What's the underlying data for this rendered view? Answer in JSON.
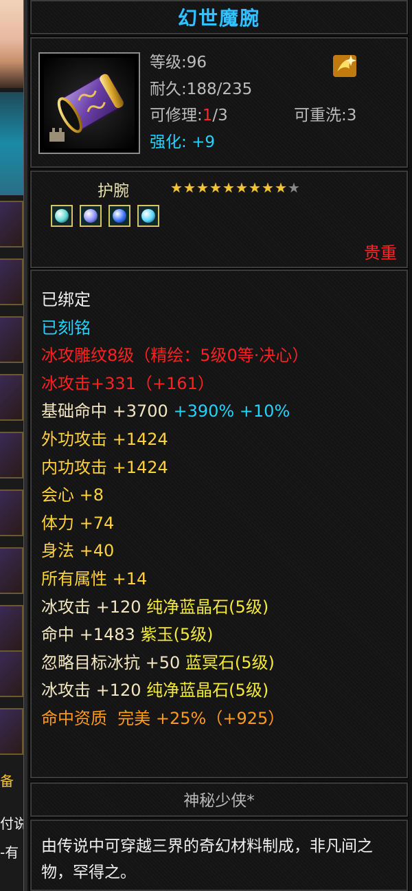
{
  "side_panel": {
    "visible_text": [
      "备",
      "付说",
      "-有"
    ]
  },
  "item": {
    "name": "幻世魔腕",
    "level_label": "等级",
    "level_value": ":96",
    "durability_label": "耐久",
    "durability_value": ":188/235",
    "repair_label": "可修理:",
    "repair_used": "1",
    "repair_total": "/3",
    "rewash_label": "可重洗:",
    "rewash_value": "3",
    "enhance_label": "强化:",
    "enhance_value": "+9",
    "type": "护腕",
    "stars": {
      "filled": 9,
      "total": 10
    },
    "gems": [
      {
        "name": "gem-slot-1",
        "color": "#5fd6d0"
      },
      {
        "name": "gem-slot-2",
        "color": "#8a8cff"
      },
      {
        "name": "gem-slot-3",
        "color": "#3a72ff"
      },
      {
        "name": "gem-slot-4",
        "color": "#58d6ff"
      }
    ],
    "rarity": "贵重",
    "owner": "神秘少侠*",
    "description": "由传说中可穿越三界的奇幻材料制成，非凡间之物，罕得之。"
  },
  "attributes": [
    {
      "segments": [
        {
          "text": "已绑定",
          "color": "#f0f0f0"
        }
      ]
    },
    {
      "segments": [
        {
          "text": "已刻铭",
          "color": "#22d3ff"
        }
      ]
    },
    {
      "segments": [
        {
          "text": "冰攻雕纹8级（精绘：5级0等·决心）",
          "color": "#ff2020"
        }
      ]
    },
    {
      "segments": [
        {
          "text": "冰攻击+331（+161）",
          "color": "#ff2020"
        }
      ]
    },
    {
      "segments": [
        {
          "text": "基础命中 +3700 ",
          "color": "#f3e7c2"
        },
        {
          "text": "+390% +10%",
          "color": "#22d3ff"
        }
      ]
    },
    {
      "segments": [
        {
          "text": "外功攻击 +1424",
          "color": "#ffd23a"
        }
      ]
    },
    {
      "segments": [
        {
          "text": "内功攻击 +1424",
          "color": "#ffd23a"
        }
      ]
    },
    {
      "segments": [
        {
          "text": "会心 +8",
          "color": "#ffd23a"
        }
      ]
    },
    {
      "segments": [
        {
          "text": "体力 +74",
          "color": "#ffd23a"
        }
      ]
    },
    {
      "segments": [
        {
          "text": "身法 +40",
          "color": "#ffd23a"
        }
      ]
    },
    {
      "segments": [
        {
          "text": "所有属性 +14",
          "color": "#ffd23a"
        }
      ]
    },
    {
      "segments": [
        {
          "text": "冰攻击 +120 ",
          "color": "#f3e7c2"
        },
        {
          "text": "纯净蓝晶石(5级)",
          "color": "#f4ea3a"
        }
      ]
    },
    {
      "segments": [
        {
          "text": "命中 +1483 ",
          "color": "#f3e7c2"
        },
        {
          "text": "紫玉(5级)",
          "color": "#f4ea3a"
        }
      ]
    },
    {
      "segments": [
        {
          "text": "忽略目标冰抗 +50 ",
          "color": "#f3e7c2"
        },
        {
          "text": "蓝冥石(5级)",
          "color": "#f4ea3a"
        }
      ]
    },
    {
      "segments": [
        {
          "text": "冰攻击 +120 ",
          "color": "#f3e7c2"
        },
        {
          "text": "纯净蓝晶石(5级)",
          "color": "#f4ea3a"
        }
      ]
    },
    {
      "segments": [
        {
          "text": "命中资质  完美 +25%（+925）",
          "color": "#ff9a1a"
        }
      ]
    }
  ]
}
